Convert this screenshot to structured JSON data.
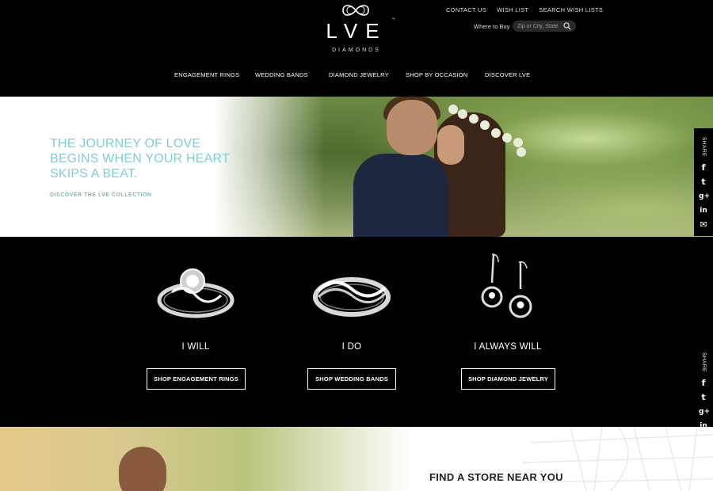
{
  "brand": {
    "logo_text": "LVE",
    "logo_tm": "™",
    "logo_sub": "DIAMONDS"
  },
  "utility_links": [
    "CONTACT US",
    "WISH LIST",
    "SEARCH WISH LISTS"
  ],
  "where_to_buy": {
    "label": "Where to Buy",
    "placeholder": "Zip or City, State"
  },
  "nav": [
    "ENGAGEMENT RINGS",
    "WEDDING BANDS",
    "DIAMOND JEWELRY",
    "SHOP BY OCCASION",
    "DISCOVER LVE"
  ],
  "hero": {
    "title": "THE JOURNEY OF LOVE BEGINS WHEN YOUR HEART SKIPS A BEAT.",
    "link": "DISCOVER THE LVE COLLECTION"
  },
  "products": [
    {
      "name": "I WILL",
      "button": "SHOP ENGAGEMENT RINGS"
    },
    {
      "name": "I DO",
      "button": "SHOP WEDDING BANDS"
    },
    {
      "name": "I ALWAYS WILL",
      "button": "SHOP DIAMOND JEWELRY"
    }
  ],
  "share": {
    "label": "SHARE",
    "icons": [
      "facebook-icon",
      "twitter-icon",
      "google-plus-icon",
      "linkedin-icon",
      "email-icon"
    ]
  },
  "store_finder": {
    "title": "FIND A STORE NEAR YOU"
  },
  "colors": {
    "accent": "#7fcdd8",
    "background": "#000000"
  }
}
